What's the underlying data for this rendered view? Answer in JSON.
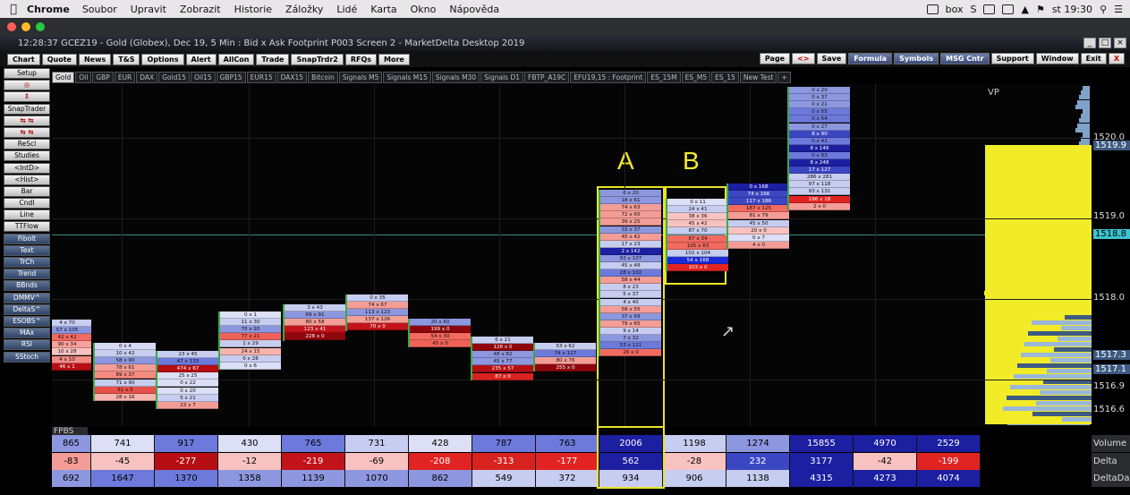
{
  "macbar": {
    "app": "Chrome",
    "menus": [
      "Soubor",
      "Upravit",
      "Zobrazit",
      "Historie",
      "Záložky",
      "Lidé",
      "Karta",
      "Okno",
      "Nápověda"
    ],
    "status_box": "box",
    "status_s": "S",
    "clock": "st 19:30"
  },
  "window": {
    "title": "12:28:37   GCEZ19 - Gold (Globex), Dec 19, 5 Min : Bid x Ask Footprint   P003 Screen 2 - MarketDelta Desktop 2019"
  },
  "toolbar": {
    "left": [
      "Chart",
      "Quote",
      "News",
      "T&S",
      "Options",
      "Alert",
      "AllCon",
      "Trade",
      "SnapTrdr2",
      "RFQs",
      "More"
    ],
    "right": [
      "Page",
      "<>",
      "Save",
      "Formula",
      "Symbols",
      "MSG Cntr",
      "Support",
      "Window",
      "Exit",
      "X"
    ]
  },
  "leftbar": [
    "Setup",
    "◎",
    "↕",
    "SnapTrader",
    "⇆  ⇆",
    "⇆  ⇆",
    "ReScl",
    "Studies",
    "<IntD>",
    "<Hist>",
    "Bar",
    "CndI",
    "Line",
    "TTFlow",
    "Fibolt",
    "Text",
    "TrCh",
    "Trend",
    "BBnds",
    "DMMV^",
    "DeltaS^",
    "ESOBS^",
    "MAx",
    "RSI",
    "SStoch"
  ],
  "tabs": [
    "Gold",
    "Oil",
    "GBP",
    "EUR",
    "DAX",
    "Gold15",
    "Oil15",
    "GBP15",
    "EUR15",
    "DAX15",
    "Bitcoin",
    "Signals M5",
    "Signals M15",
    "Signals M30",
    "Signals D1",
    "FBTP_A19C",
    "EFU19,15 : Footprint",
    "ES_15M",
    "ES_M5",
    "ES_15",
    "New Test",
    "+"
  ],
  "chart": {
    "label_a": "A",
    "label_b": "B",
    "vp_label": "VP",
    "price_labels": [
      "1520.0",
      "1519.9",
      "1519.0",
      "1518.8",
      "1518.0",
      "1517.3",
      "1517.1",
      "1516.9",
      "1516.6"
    ],
    "footprint_columns": [
      {
        "cells": [
          [
            "4 x 70",
            "#c9cdf0"
          ],
          [
            "57 x 105",
            "#8a95df"
          ],
          [
            "42 x 42",
            "#f26a60"
          ],
          [
            "90 x 34",
            "#f9a19a"
          ],
          [
            "10 x 28",
            "#f7c2c0"
          ],
          [
            "4 x 10",
            "#f48a84"
          ],
          [
            "46 x 1",
            "#b60e12"
          ]
        ]
      },
      {
        "cells": [
          [
            "0 x 4",
            "#d6d9f3"
          ],
          [
            "10 x 42",
            "#c7cdf0"
          ],
          [
            "58 x 90",
            "#8d97df"
          ],
          [
            "78 x 61",
            "#f49d96"
          ],
          [
            "89 x 37",
            "#f58a80"
          ],
          [
            "71 x 90",
            "#c7cdf0"
          ],
          [
            "51 x 5",
            "#e8504a"
          ],
          [
            "28 x 16",
            "#f7b3ad"
          ]
        ]
      },
      {
        "cells": [
          [
            "23 x 45",
            "#c7cdf0"
          ],
          [
            "47 x 133",
            "#6d7adb"
          ],
          [
            "474 x 67",
            "#b60e12"
          ],
          [
            "25 x 25",
            "#dcdff5"
          ],
          [
            "0 x 22",
            "#dcdff5"
          ],
          [
            "0 x 20",
            "#dcdff5"
          ],
          [
            "5 x 21",
            "#c7cdf0"
          ],
          [
            "23 x 7",
            "#f49d96"
          ]
        ]
      },
      {
        "cells": [
          [
            "0 x 1",
            "#dcdff5"
          ],
          [
            "11 x 30",
            "#c7cdf0"
          ],
          [
            "70 x 93",
            "#8d97df"
          ],
          [
            "77 x 21",
            "#f06258"
          ],
          [
            "1 x 29",
            "#c7cdf0"
          ],
          [
            "24 x 15",
            "#f7b3ad"
          ],
          [
            "0 x 28",
            "#c7cdf0"
          ],
          [
            "0 x 6",
            "#dcdff5"
          ]
        ]
      },
      {
        "cells": [
          [
            "3 x 43",
            "#c7cdf0"
          ],
          [
            "69 x 91",
            "#8d97df"
          ],
          [
            "80 x 58",
            "#f49d96"
          ],
          [
            "123 x 41",
            "#c2121a"
          ],
          [
            "228 x 0",
            "#8f070c"
          ]
        ]
      },
      {
        "cells": [
          [
            "0 x 35",
            "#c7cdf0"
          ],
          [
            "74 x 67",
            "#f49d96"
          ],
          [
            "113 x 123",
            "#8d97df"
          ],
          [
            "137 x 126",
            "#f49d96"
          ],
          [
            "70 x 0",
            "#c2121a"
          ]
        ]
      },
      {
        "cells": [
          [
            "20 x 60",
            "#8d97df"
          ],
          [
            "199 x 0",
            "#8f070c"
          ],
          [
            "54 x 30",
            "#f26a60"
          ],
          [
            "45 x 0",
            "#f06258"
          ]
        ]
      },
      {
        "cells": [
          [
            "6 x 21",
            "#c7cdf0"
          ],
          [
            "128 x 0",
            "#8f070c"
          ],
          [
            "48 x 82",
            "#8d97df"
          ],
          [
            "45 x 77",
            "#8d97df"
          ],
          [
            "235 x 57",
            "#b60e12"
          ],
          [
            "87 x 0",
            "#d8221f"
          ]
        ]
      },
      {
        "cells": [
          [
            "53 x 62",
            "#c7cdf0"
          ],
          [
            "74 x 127",
            "#6d7adb"
          ],
          [
            "80 x 76",
            "#f49d96"
          ],
          [
            "255 x 0",
            "#8f070c"
          ]
        ]
      },
      {
        "cells": [
          [
            "6 x 20",
            "#8d97df"
          ],
          [
            "18 x 61",
            "#8d97df"
          ],
          [
            "74 x 63",
            "#f49d96"
          ],
          [
            "72 x 65",
            "#f49d96"
          ],
          [
            "39 x 25",
            "#f49d96"
          ],
          [
            "33 x 37",
            "#8d97df"
          ],
          [
            "45 x 42",
            "#f49d96"
          ],
          [
            "17 x 23",
            "#c7cdf0"
          ],
          [
            "2 x 142",
            "#1c1fa0"
          ],
          [
            "93 x 107",
            "#8d97df"
          ],
          [
            "45 x 48",
            "#c7cdf0"
          ],
          [
            "28 x 102",
            "#6d7adb"
          ],
          [
            "58 x 44",
            "#f49d96"
          ],
          [
            "8 x 23",
            "#c7cdf0"
          ],
          [
            "5 x 37",
            "#c7cdf0"
          ],
          [
            "4 x 40",
            "#c7cdf0"
          ],
          [
            "58 x 55",
            "#f49d96"
          ],
          [
            "37 x 69",
            "#8d97df"
          ],
          [
            "79 x 65",
            "#f49d96"
          ],
          [
            "9 x 14",
            "#c7cdf0"
          ],
          [
            "7 x 32",
            "#8d97df"
          ],
          [
            "53 x 111",
            "#6d7adb"
          ],
          [
            "26 x 0",
            "#f26a60"
          ]
        ]
      },
      {
        "cells": [
          [
            "0 x 11",
            "#dcdff5"
          ],
          [
            "24 x 41",
            "#c7cdf0"
          ],
          [
            "38 x 36",
            "#f7c2c0"
          ],
          [
            "45 x 42",
            "#f7c2c0"
          ],
          [
            "87 x 70",
            "#c7cdf0"
          ],
          [
            "67 x 34",
            "#f26a60"
          ],
          [
            "105 x 63",
            "#f26a60"
          ],
          [
            "102 x 104",
            "#c7cdf0"
          ],
          [
            "54 x 168",
            "#1c2bd8"
          ],
          [
            "103 x 0",
            "#e12421"
          ]
        ]
      },
      {
        "cells": [
          [
            "0 x 168",
            "#1c1fa0"
          ],
          [
            "74 x 166",
            "#3c47c4"
          ],
          [
            "117 x 186",
            "#3c47c4"
          ],
          [
            "187 x 125",
            "#f26a60"
          ],
          [
            "81 x 79",
            "#f49d96"
          ],
          [
            "45 x 50",
            "#c7cdf0"
          ],
          [
            "20 x 0",
            "#f7c2c0"
          ],
          [
            "0 x 7",
            "#dcdff5"
          ],
          [
            "4 x 0",
            "#f49d96"
          ]
        ]
      },
      {
        "cells": [
          [
            "0 x 20",
            "#8d97df"
          ],
          [
            "0 x 37",
            "#8d97df"
          ],
          [
            "0 x 21",
            "#8d97df"
          ],
          [
            "0 x 55",
            "#6d7adb"
          ],
          [
            "0 x 54",
            "#6d7adb"
          ],
          [
            "0 x 27",
            "#8d97df"
          ],
          [
            "8 x 90",
            "#3c47c4"
          ],
          [
            "0 x 41",
            "#6d7adb"
          ],
          [
            "8 x 146",
            "#1c1fa0"
          ],
          [
            "0 x 83",
            "#6d7adb"
          ],
          [
            "8 x 248",
            "#1c1fa0"
          ],
          [
            "17 x 127",
            "#3c47c4"
          ],
          [
            "286 x 281",
            "#c7cdf0"
          ],
          [
            "97 x 118",
            "#c7cdf0"
          ],
          [
            "93 x 131",
            "#c7cdf0"
          ],
          [
            "186 x 18",
            "#e12421"
          ],
          [
            "2 x 0",
            "#f49d96"
          ]
        ]
      }
    ]
  },
  "stats": {
    "fpbs_label": "FPBS",
    "rows": [
      {
        "label": "Volume",
        "values": [
          "865",
          "741",
          "917",
          "430",
          "765",
          "731",
          "428",
          "787",
          "763",
          "2006",
          "1198",
          "1274",
          "15855",
          "4970",
          "2529"
        ],
        "colors": [
          "#8d97df",
          "#dcdff5",
          "#6d7adb",
          "#dcdff5",
          "#6d7adb",
          "#c7cdf0",
          "#dcdff5",
          "#6d7adb",
          "#6d7adb",
          "#1c1fa0",
          "#c7cdf0",
          "#8d97df",
          "#1c1fa0",
          "#1c1fa0",
          "#1c1fa0"
        ]
      },
      {
        "label": "Delta",
        "values": [
          "-83",
          "-45",
          "-277",
          "-12",
          "-219",
          "-69",
          "-208",
          "-313",
          "-177",
          "562",
          "-28",
          "232",
          "3177",
          "-42",
          "-199"
        ],
        "colors": [
          "#f49d96",
          "#f7c2c0",
          "#b60e12",
          "#f7c2c0",
          "#c2121a",
          "#f7c2c0",
          "#e12421",
          "#d8221f",
          "#e12421",
          "#1c1fa0",
          "#f7c2c0",
          "#3c47c4",
          "#1c1fa0",
          "#f7c2c0",
          "#e12421"
        ]
      },
      {
        "label": "DeltaDay",
        "values": [
          "692",
          "1647",
          "1370",
          "1358",
          "1139",
          "1070",
          "862",
          "549",
          "372",
          "934",
          "906",
          "1138",
          "4315",
          "4273",
          "4074"
        ],
        "colors": [
          "#8d97df",
          "#6d7adb",
          "#6d7adb",
          "#8d97df",
          "#8d97df",
          "#8d97df",
          "#8d97df",
          "#c7cdf0",
          "#c7cdf0",
          "#c7cdf0",
          "#c7cdf0",
          "#c7cdf0",
          "#1c1fa0",
          "#1c1fa0",
          "#1c1fa0"
        ]
      }
    ]
  }
}
